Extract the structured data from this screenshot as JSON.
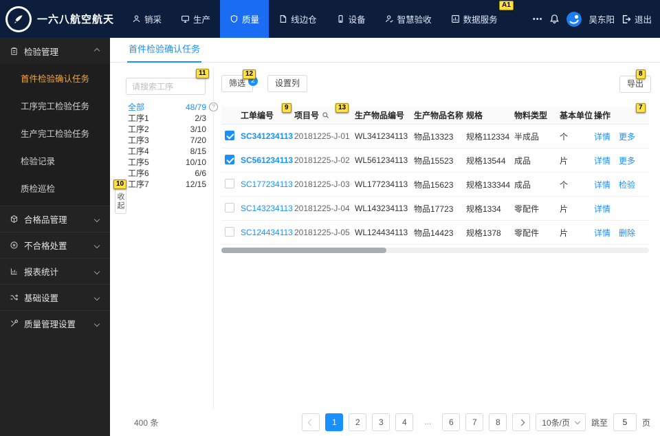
{
  "som_labels": {
    "a1": "A1",
    "n7": "7",
    "n8": "8",
    "n9": "9",
    "n10": "10",
    "n11": "11",
    "n12": "12",
    "n13": "13"
  },
  "colors": {
    "accent_blue": "#1890ff",
    "navbar_bg": "#0c1e3c",
    "active_nav_bg": "#1a6df2",
    "sidebar_active_text": "#f0a63c",
    "som_yellow": "#ffe04a"
  },
  "navbar": {
    "brand": "一六八航空航天",
    "items": [
      {
        "label": "销采"
      },
      {
        "label": "生产"
      },
      {
        "label": "质量"
      },
      {
        "label": "线边仓"
      },
      {
        "label": "设备"
      },
      {
        "label": "智慧验收"
      },
      {
        "label": "数据服务"
      }
    ],
    "more": "•••",
    "user_name": "吴东阳",
    "logout_label": "退出"
  },
  "sidebar": {
    "sections": [
      {
        "label": "检验管理"
      },
      {
        "label": "合格品管理"
      },
      {
        "label": "不合格处置"
      },
      {
        "label": "报表统计"
      },
      {
        "label": "基础设置"
      },
      {
        "label": "质量管理设置"
      }
    ],
    "inspection_children": [
      "首件检验确认任务",
      "工序完工检验任务",
      "生产完工检验任务",
      "检验记录",
      "质检巡检"
    ]
  },
  "tab": {
    "label": "首件检验确认任务"
  },
  "process_panel": {
    "search_placeholder": "请搜索工序",
    "all_label": "全部",
    "all_count": "48/79",
    "rows": [
      [
        "工序1",
        "2/3"
      ],
      [
        "工序2",
        "3/10"
      ],
      [
        "工序3",
        "7/20"
      ],
      [
        "工序4",
        "8/15"
      ],
      [
        "工序5",
        "10/10"
      ],
      [
        "工序6",
        "6/6"
      ],
      [
        "工序7",
        "12/15"
      ]
    ],
    "collapse_label": "收起"
  },
  "toolbar": {
    "filter_label": "筛选",
    "filter_count": "2",
    "columns_label": "设置列",
    "export_label": "导出"
  },
  "table": {
    "headers": [
      "工单编号",
      "项目号",
      "生产物品编号",
      "生产物品名称",
      "规格",
      "物料类型",
      "基本单位",
      "操作"
    ],
    "rows": [
      {
        "checked": true,
        "order_no": "SC341234113",
        "project_no": "20181225-J-01",
        "item_code": "WL341234113",
        "item_name": "物品13323",
        "spec": "规格112334",
        "material_type": "半成品",
        "unit": "个",
        "action1": "详情",
        "action2": "更多"
      },
      {
        "checked": true,
        "order_no": "SC561234113",
        "project_no": "20181225-J-02",
        "item_code": "WL561234113",
        "item_name": "物品15523",
        "spec": "规格13544",
        "material_type": "成品",
        "unit": "片",
        "action1": "详情",
        "action2": "更多"
      },
      {
        "checked": false,
        "order_no": "SC177234113",
        "project_no": "20181225-J-03",
        "item_code": "WL177234113",
        "item_name": "物品15623",
        "spec": "规格133344",
        "material_type": "成品",
        "unit": "个",
        "action1": "详情",
        "action2": "检验"
      },
      {
        "checked": false,
        "order_no": "SC143234113",
        "project_no": "20181225-J-04",
        "item_code": "WL143234113",
        "item_name": "物品17723",
        "spec": "规格1334",
        "material_type": "零配件",
        "unit": "片",
        "action1": "详情",
        "action2": ""
      },
      {
        "checked": false,
        "order_no": "SC124434113",
        "project_no": "20181225-J-05",
        "item_code": "WL124434113",
        "item_name": "物品14423",
        "spec": "规格1378",
        "material_type": "零配件",
        "unit": "片",
        "action1": "详情",
        "action2": "删除"
      }
    ]
  },
  "pagination": {
    "total": "400 条",
    "pages": [
      "1",
      "2",
      "3",
      "4",
      "...",
      "6",
      "7",
      "8"
    ],
    "active_page": "1",
    "page_size": "10条/页",
    "jump_label": "跳至",
    "jump_value": "5",
    "jump_unit": "页"
  }
}
